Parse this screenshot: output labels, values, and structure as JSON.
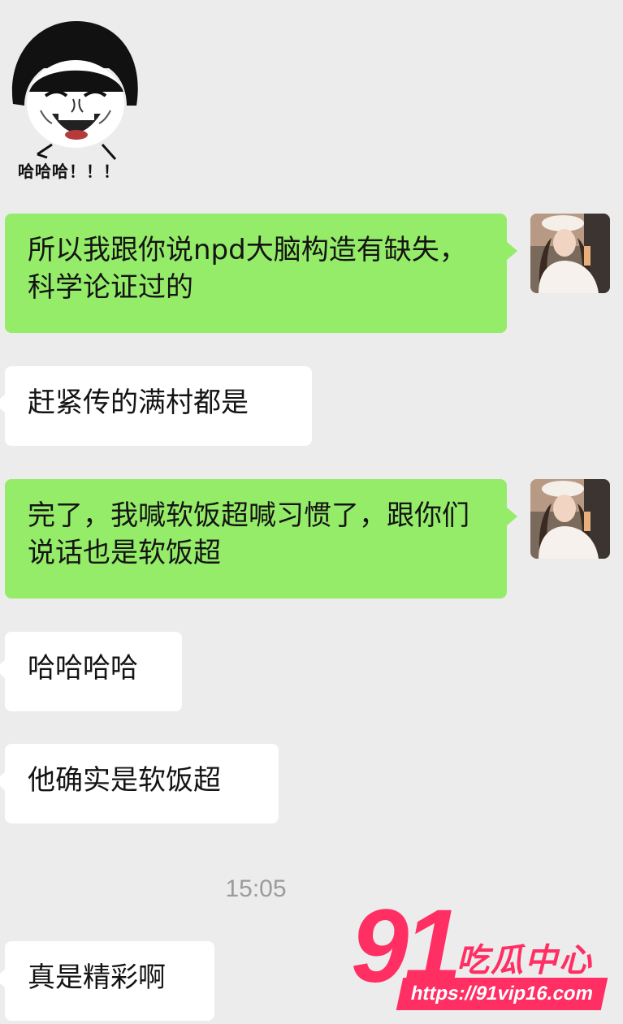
{
  "sticker": {
    "icon": "laughing-meme-face",
    "caption": "哈哈哈！！！"
  },
  "messages": [
    {
      "side": "right",
      "text": "所以我跟你说npd大脑构造有缺失，科学论证过的"
    },
    {
      "side": "left",
      "text": "赶紧传的满村都是"
    },
    {
      "side": "right",
      "text": "完了，我喊软饭超喊习惯了，跟你们说话也是软饭超"
    },
    {
      "side": "left",
      "text": "哈哈哈哈"
    },
    {
      "side": "left",
      "text": "他确实是软饭超"
    },
    {
      "side": "left",
      "text": "真是精彩啊"
    }
  ],
  "timestamp": "15:05",
  "watermark": {
    "number": "91",
    "name": "吃瓜中心",
    "url": "https://91vip16.com"
  },
  "colors": {
    "background": "#ececec",
    "sent_bubble": "#95ec69",
    "received_bubble": "#ffffff",
    "watermark": "#ff2e63",
    "timestamp": "#9b9b9b"
  }
}
